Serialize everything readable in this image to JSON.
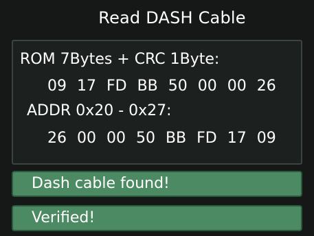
{
  "header": {
    "title": "Read DASH Cable"
  },
  "rom": {
    "label": "ROM 7Bytes + CRC 1Byte:",
    "bytes": "09 17 FD BB 50 00 00 26"
  },
  "addr": {
    "label": "ADDR 0x20 - 0x27:",
    "bytes": "26 00 00 50 BB FD 17 09"
  },
  "status": [
    {
      "text": "Dash cable found!"
    },
    {
      "text": "Verified!"
    }
  ],
  "colors": {
    "background": "#161817",
    "panel": "#1c2120",
    "status_green": "#4b8a62"
  }
}
